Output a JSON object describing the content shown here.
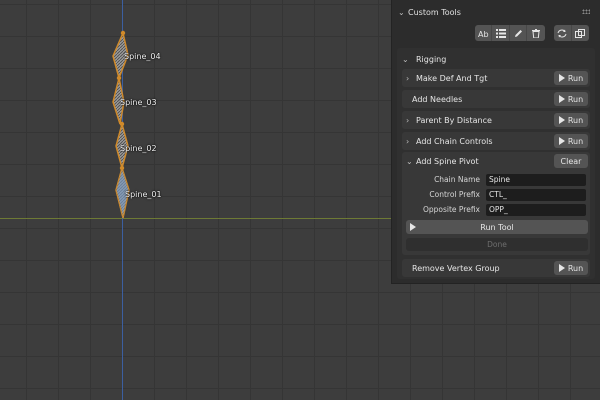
{
  "viewport": {
    "bones": [
      {
        "label": "Spine_04"
      },
      {
        "label": "Spine_03"
      },
      {
        "label": "Spine_02"
      },
      {
        "label": "Spine_01"
      }
    ],
    "colors": {
      "x_axis": "#6e7a35",
      "y_axis": "#3c5fa0",
      "bone_selected": "#d08a2a",
      "bone_active": "#7a9ac0"
    }
  },
  "panel": {
    "title": "Custom Tools",
    "toolbar_icons": [
      "text-icon",
      "list-icon",
      "pencil-icon",
      "trash-icon",
      "refresh-icon",
      "copy-icon"
    ],
    "rigging": {
      "title": "Rigging",
      "rows": {
        "make_def": {
          "label": "Make Def And Tgt",
          "button": "Run"
        },
        "add_needles": {
          "label": "Add Needles",
          "button": "Run"
        },
        "parent_dist": {
          "label": "Parent By Distance",
          "button": "Run"
        },
        "chain_controls": {
          "label": "Add Chain Controls",
          "button": "Run"
        },
        "spine_pivot": {
          "label": "Add Spine Pivot",
          "button": "Clear",
          "fields": {
            "chain_name": {
              "label": "Chain Name",
              "value": "Spine"
            },
            "control_prefix": {
              "label": "Control Prefix",
              "value": "CTL_"
            },
            "opposite_prefix": {
              "label": "Opposite Prefix",
              "value": "OPP_"
            }
          },
          "run_tool": "Run Tool",
          "done": "Done"
        },
        "remove_vertex": {
          "label": "Remove Vertex Group",
          "button": "Run"
        }
      }
    }
  }
}
